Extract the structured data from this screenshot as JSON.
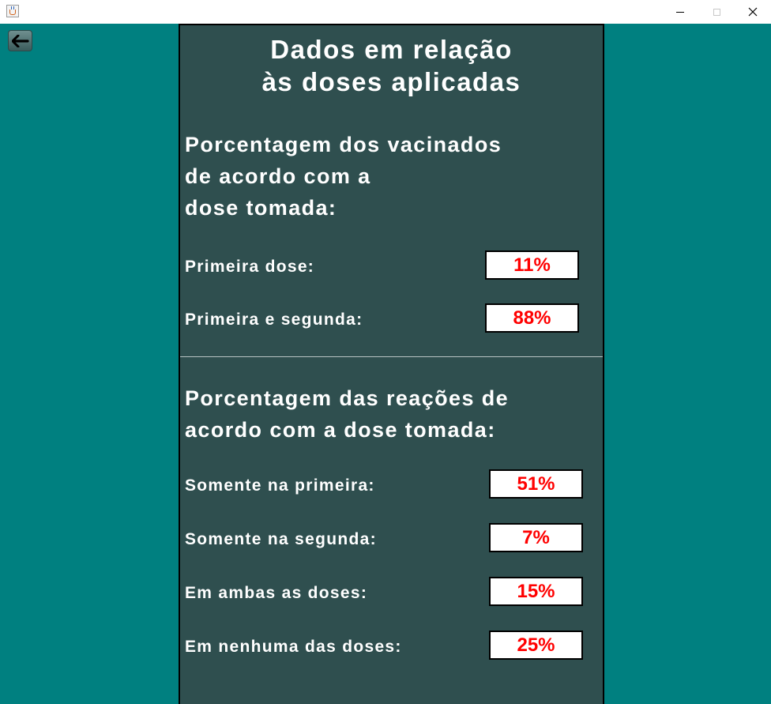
{
  "window": {
    "title": "",
    "controls": {
      "minimize_icon": "minimize-icon",
      "maximize_icon": "maximize-icon",
      "close_icon": "close-icon"
    }
  },
  "back_button": {
    "icon": "arrow-left-icon"
  },
  "panel": {
    "title_line1": "Dados em relação",
    "title_line2": "às doses aplicadas",
    "vaccinated": {
      "heading_line1": "Porcentagem dos vacinados",
      "heading_line2": "de acordo com a",
      "heading_line3": "dose tomada:",
      "rows": [
        {
          "label": "Primeira dose:",
          "value": "11%"
        },
        {
          "label": "Primeira e segunda:",
          "value": "88%"
        }
      ]
    },
    "reactions": {
      "heading_line1": "Porcentagem das reações de",
      "heading_line2": "acordo com a dose tomada:",
      "rows": [
        {
          "label": "Somente na primeira:",
          "value": "51%"
        },
        {
          "label": "Somente na segunda:",
          "value": "7%"
        },
        {
          "label": "Em ambas as doses:",
          "value": "15%"
        },
        {
          "label": "Em nenhuma das doses:",
          "value": "25%"
        }
      ]
    }
  },
  "colors": {
    "background": "#008080",
    "panel": "#2f4f4f",
    "text": "#ffffff",
    "value_text": "#ff0000",
    "value_box": "#ffffff"
  }
}
